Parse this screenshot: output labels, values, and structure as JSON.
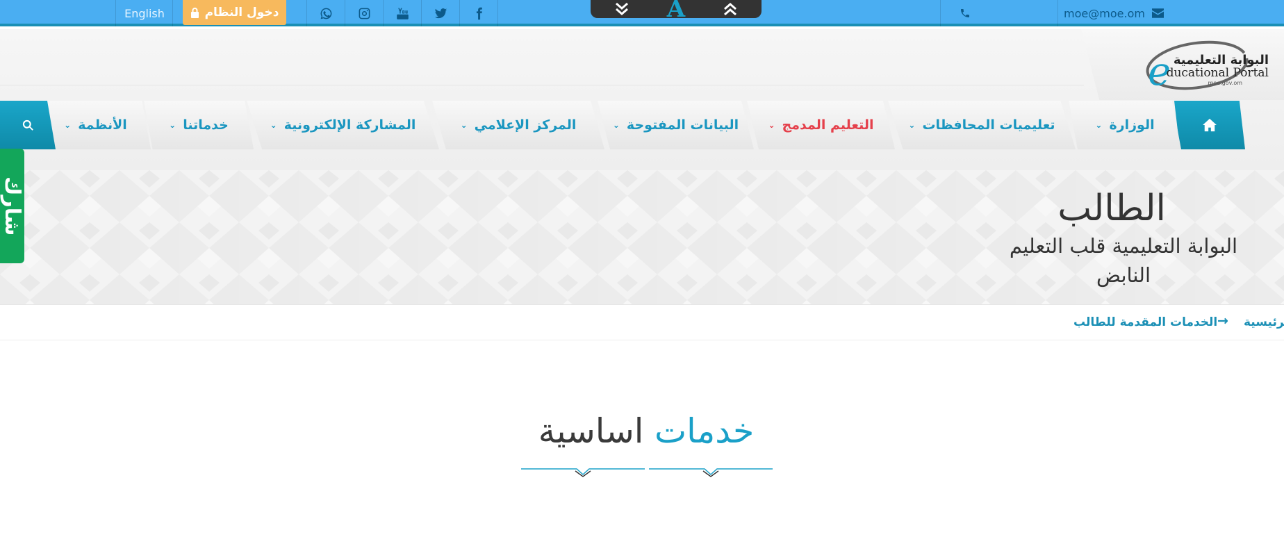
{
  "topbar": {
    "language_label": "English",
    "login_label": "دخول النظام",
    "social_icons": [
      "whatsapp-icon",
      "instagram-icon",
      "youtube-icon",
      "twitter-icon",
      "facebook-icon"
    ],
    "accessibility": {
      "font_icon_label": "A"
    },
    "email": "moe@moe.om"
  },
  "logo": {
    "name_ar": "البوابة التعليمية",
    "name_en": "ducational Portal",
    "letter": "e",
    "url": "moe.gov.om"
  },
  "nav": {
    "items": [
      {
        "label": "الوزارة",
        "has_dropdown": true
      },
      {
        "label": "تعليميات المحافظات",
        "has_dropdown": true
      },
      {
        "label": "التعليم المدمج",
        "has_dropdown": true,
        "active": true
      },
      {
        "label": "البيانات المفتوحة",
        "has_dropdown": true
      },
      {
        "label": "المركز الإعلامي",
        "has_dropdown": true
      },
      {
        "label": "المشاركة الإلكترونية",
        "has_dropdown": true
      },
      {
        "label": "خدماتنا",
        "has_dropdown": true
      },
      {
        "label": "الأنظمة",
        "has_dropdown": true
      }
    ]
  },
  "hero": {
    "title": "الطالب",
    "subtitle": "البوابة التعليمية قلب التعليم النابض"
  },
  "side_tab": {
    "label": "شارك"
  },
  "breadcrumb": {
    "home": "الرئيسية",
    "separator": "→",
    "current": "الخدمات المقدمة للطالب"
  },
  "section": {
    "title_highlight": "خدمات",
    "title_rest": "اساسية"
  },
  "colors": {
    "topbar": "#4aaef2",
    "accent": "#1a96c0",
    "login": "#f7b95d",
    "active_nav": "#e5404b",
    "side_tab": "#13a65a"
  }
}
